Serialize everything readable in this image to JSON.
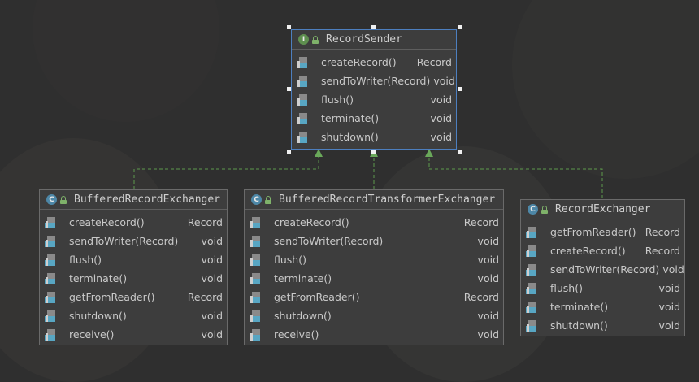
{
  "colors": {
    "canvas_background": "#2f2f2f",
    "box_background": "#3d3d3d",
    "box_border": "#6a6a6a",
    "selected_border": "#4d7fbf",
    "edge_dashed": "#5d9a4c",
    "interface_badge": "#5e8f4f",
    "class_badge": "#4d87a7"
  },
  "icons": {
    "interface_badge": "interface-icon",
    "class_badge": "class-icon",
    "visibility": "lock-icon",
    "method": "method-icon"
  },
  "interface": {
    "badge": "I",
    "name": "RecordSender",
    "methods": [
      {
        "name": "createRecord()",
        "type": "Record"
      },
      {
        "name": "sendToWriter(Record)",
        "type": "void"
      },
      {
        "name": "flush()",
        "type": "void"
      },
      {
        "name": "terminate()",
        "type": "void"
      },
      {
        "name": "shutdown()",
        "type": "void"
      }
    ]
  },
  "classes": [
    {
      "badge": "C",
      "name": "BufferedRecordExchanger",
      "methods": [
        {
          "name": "createRecord()",
          "type": "Record"
        },
        {
          "name": "sendToWriter(Record)",
          "type": "void"
        },
        {
          "name": "flush()",
          "type": "void"
        },
        {
          "name": "terminate()",
          "type": "void"
        },
        {
          "name": "getFromReader()",
          "type": "Record"
        },
        {
          "name": "shutdown()",
          "type": "void"
        },
        {
          "name": "receive()",
          "type": "void"
        }
      ]
    },
    {
      "badge": "C",
      "name": "BufferedRecordTransformerExchanger",
      "methods": [
        {
          "name": "createRecord()",
          "type": "Record"
        },
        {
          "name": "sendToWriter(Record)",
          "type": "void"
        },
        {
          "name": "flush()",
          "type": "void"
        },
        {
          "name": "terminate()",
          "type": "void"
        },
        {
          "name": "getFromReader()",
          "type": "Record"
        },
        {
          "name": "shutdown()",
          "type": "void"
        },
        {
          "name": "receive()",
          "type": "void"
        }
      ]
    },
    {
      "badge": "C",
      "name": "RecordExchanger",
      "methods": [
        {
          "name": "getFromReader()",
          "type": "Record"
        },
        {
          "name": "createRecord()",
          "type": "Record"
        },
        {
          "name": "sendToWriter(Record)",
          "type": "void"
        },
        {
          "name": "flush()",
          "type": "void"
        },
        {
          "name": "terminate()",
          "type": "void"
        },
        {
          "name": "shutdown()",
          "type": "void"
        }
      ]
    }
  ]
}
